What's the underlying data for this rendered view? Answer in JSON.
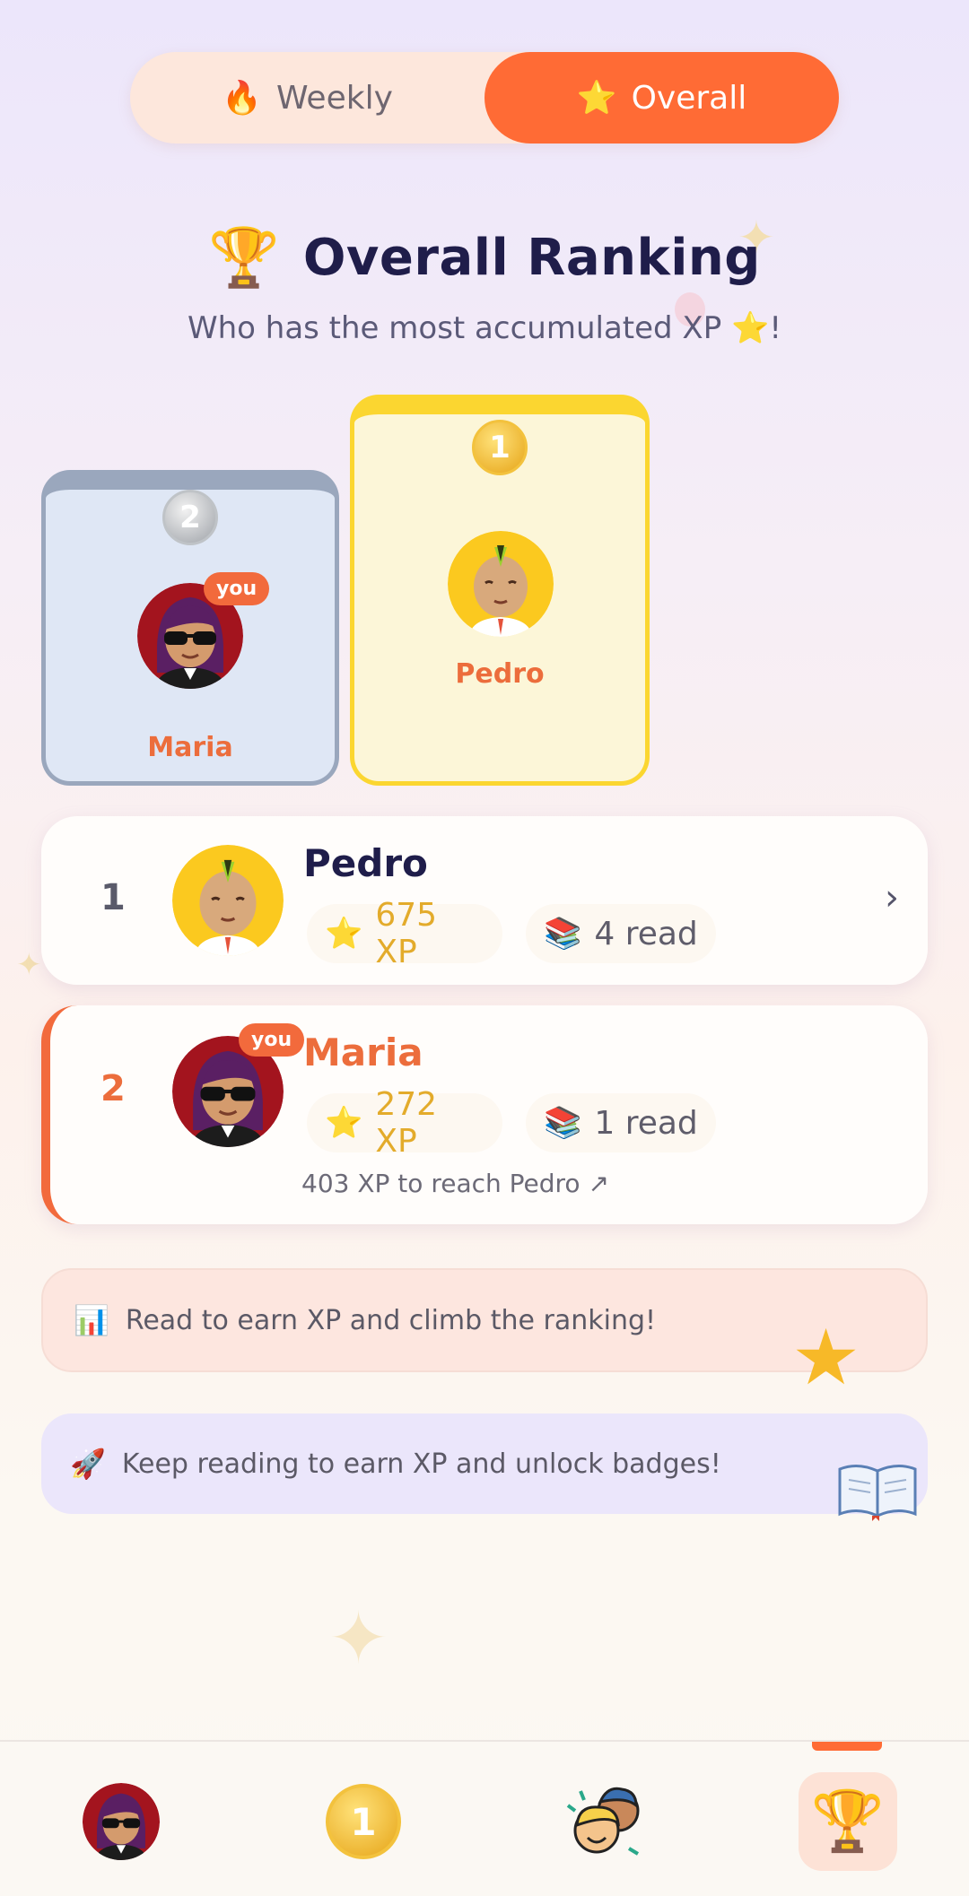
{
  "tabs": {
    "weekly": {
      "icon": "🔥",
      "label": "Weekly"
    },
    "overall": {
      "icon": "⭐",
      "label": "Overall",
      "active": true
    }
  },
  "header": {
    "icon": "🏆",
    "title": "Overall Ranking",
    "subtitle": "Who has the most accumulated XP ⭐!"
  },
  "podium": [
    {
      "place": "2",
      "name": "Maria",
      "is_you": true,
      "you_label": "you"
    },
    {
      "place": "1",
      "name": "Pedro",
      "is_you": false
    }
  ],
  "ranking": [
    {
      "rank": "1",
      "name": "Pedro",
      "xp_icon": "⭐",
      "xp": "675 XP",
      "read_icon": "📚",
      "read": "4 read",
      "chevron": "›"
    },
    {
      "rank": "2",
      "name": "Maria",
      "you_label": "you",
      "xp_icon": "⭐",
      "xp": "272 XP",
      "read_icon": "📚",
      "read": "1 read",
      "progress_text": "403 XP to reach Pedro ↗"
    }
  ],
  "banners": [
    {
      "icon": "📊",
      "text": "Read to earn XP and climb the ranking!"
    },
    {
      "icon": "🚀",
      "text": "Keep reading to earn XP and unlock badges!"
    }
  ],
  "bottom_nav": {
    "coin_label": "1",
    "active": "ranking"
  },
  "colors": {
    "accent": "#ff6b35",
    "gold": "#fbd630",
    "silver": "#9aa7bd",
    "xp": "#e3ab2b"
  }
}
